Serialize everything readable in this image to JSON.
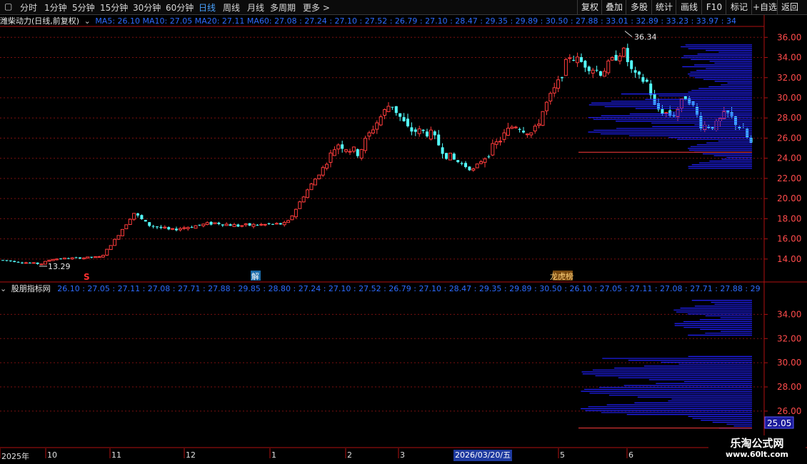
{
  "toolbar": {
    "periods": [
      {
        "label": "分时",
        "active": false
      },
      {
        "label": "1分钟",
        "active": false
      },
      {
        "label": "5分钟",
        "active": false
      },
      {
        "label": "15分钟",
        "active": false
      },
      {
        "label": "30分钟",
        "active": false
      },
      {
        "label": "60分钟",
        "active": false
      },
      {
        "label": "日线",
        "active": true
      },
      {
        "label": "周线",
        "active": false
      },
      {
        "label": "月线",
        "active": false
      },
      {
        "label": "多周期",
        "active": false
      },
      {
        "label": "更多 >",
        "active": false
      }
    ],
    "right_buttons": [
      "复权",
      "叠加",
      "多股",
      "统计",
      "画线",
      "F10",
      "标记",
      "+自选",
      "返回"
    ]
  },
  "main_info": {
    "stock_title": "潍柴动力(日线,前复权)",
    "ma_text": "MA5: 26.10  MA10: 27.05  MA20: 27.11  MA60: 27.08 : 27.24 : 27.10 : 27.52 : 26.79 : 27.10 : 28.47 : 29.35 : 29.89 : 30.50 : 27.88 : 33.01 : 32.89 : 33.23 : 33.97 : 34"
  },
  "indicator_info": {
    "title": "股朋指标网",
    "values_text": "26.10 : 27.05 : 27.11 : 27.08 : 27.71 : 27.88 : 29.85 : 28.80 : 27.24 : 27.10 : 27.52 : 26.79 : 27.10 : 28.47 : 29.35 : 29.89 : 30.50 : 26.10 : 27.05 : 27.11 : 27.08 : 27.71 : 27.88 : 29"
  },
  "price_axis": {
    "main": [
      "36.00",
      "34.00",
      "32.00",
      "30.00",
      "28.00",
      "26.00",
      "24.00",
      "22.00",
      "20.00",
      "18.00",
      "16.00",
      "14.00"
    ],
    "indicator": [
      "34.00",
      "32.00",
      "30.00",
      "28.00",
      "26.00"
    ],
    "current_price": "25.05"
  },
  "annotations": {
    "high_label": "36.34",
    "low_label": "13.29",
    "marker_s": "S",
    "marker_jie": "解",
    "marker_bang": "龙虎榜"
  },
  "time_axis": {
    "labels": [
      "2025年",
      "10",
      "11",
      "12",
      "1",
      "2",
      "3",
      "5",
      "6"
    ],
    "cursor_date": "2026/03/20/五"
  },
  "watermark": {
    "line1": "乐淘公式网",
    "line2": "www.60lt.com"
  },
  "colors": {
    "up": "#ff3c3c",
    "down": "#54ffff",
    "ma_text": "#2d6bff",
    "profile": "#2020ff",
    "border": "#b01010",
    "grid": "#7a1010"
  },
  "chart_data": {
    "type": "candlestick",
    "title": "潍柴动力(日线,前复权)",
    "ylim": [
      13,
      36.8
    ],
    "key_points": [
      {
        "label": "2025年",
        "close": 13.9
      },
      {
        "label": "low",
        "low": 13.29
      },
      {
        "label": "11",
        "close": 18.5
      },
      {
        "label": "12",
        "close": 17.3
      },
      {
        "label": "1",
        "close": 17.6
      },
      {
        "label": "2",
        "close": 25.5
      },
      {
        "label": "3",
        "close": 27.3
      },
      {
        "label": "2026/03/20",
        "close": 25.0
      },
      {
        "label": "5",
        "close": 33.5
      },
      {
        "label": "high",
        "high": 36.34
      },
      {
        "label": "last",
        "close": 25.05
      }
    ]
  }
}
